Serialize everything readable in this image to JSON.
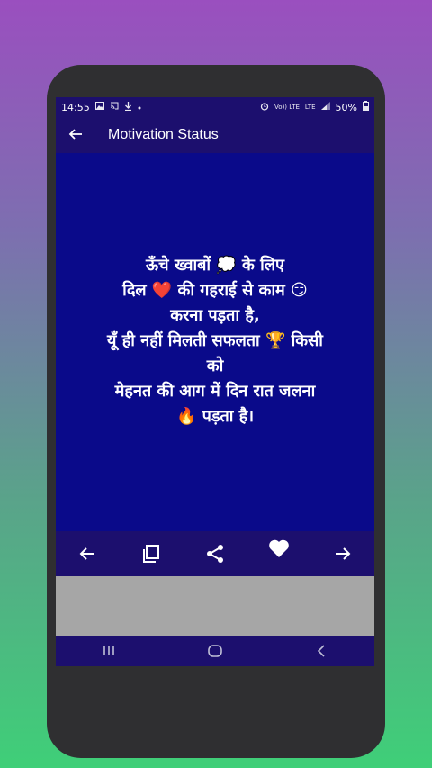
{
  "status_bar": {
    "time": "14:55",
    "left_icons": [
      "image-icon",
      "cast-icon",
      "download-icon",
      "dot-icon"
    ],
    "network_label_1": "Vo)) LTE",
    "network_label_2": "LTE",
    "battery": "50%"
  },
  "app_bar": {
    "title": "Motivation Status"
  },
  "quote": {
    "text": "ऊँचे ख्वाबों 💭 के लिए\nदिल ❤️ की गहराई से काम 😏\nकरना पड़ता है,\nयूँ ही नहीं मिलती सफलता 🏆 किसी\nको\nमेहनत की आग में दिन रात जलना\n🔥 पड़ता है।"
  },
  "toolbar": {
    "buttons": [
      "previous",
      "copy",
      "share",
      "favorite",
      "next"
    ]
  },
  "colors": {
    "background_top": "#9a4fbf",
    "background_bottom": "#3fcf78",
    "bar": "#1c0f6e",
    "content": "#0a0a8a",
    "ad": "#a6a6a6"
  }
}
